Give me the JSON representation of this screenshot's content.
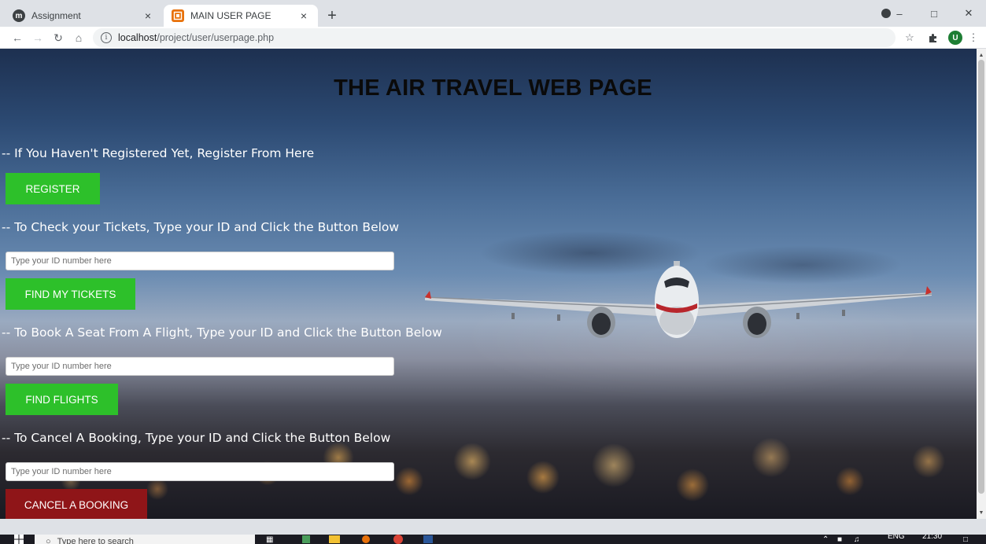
{
  "browser": {
    "tabs": [
      {
        "title": "Assignment",
        "icon": "m-favicon-icon"
      },
      {
        "title": "MAIN USER PAGE",
        "icon": "app-favicon-icon"
      }
    ],
    "new_tab_label": "+",
    "close_glyph": "×",
    "url_host": "localhost",
    "url_path": "/project/user/userpage.php",
    "profile_initial": "U"
  },
  "page": {
    "title": "THE AIR TRAVEL WEB PAGE",
    "register": {
      "label": "-- If You Haven't Registered Yet, Register From Here",
      "button": "REGISTER"
    },
    "tickets": {
      "label": "-- To Check your Tickets, Type your ID and Click the Button Below",
      "placeholder": "Type your ID number here",
      "button": "FIND MY TICKETS"
    },
    "book": {
      "label": "-- To Book A Seat From A Flight, Type your ID and Click the Button Below",
      "placeholder": "Type your ID number here",
      "button": "FIND FLIGHTS"
    },
    "cancel": {
      "label": "-- To Cancel A Booking, Type your ID and Click the Button Below",
      "placeholder": "Type your ID number here",
      "button": "CANCEL A BOOKING"
    }
  },
  "colors": {
    "green_button": "#2dc02a",
    "red_button": "#8f1518"
  },
  "taskbar": {
    "search_placeholder": "Type here to search",
    "language": "ENG",
    "time": "21:30"
  }
}
